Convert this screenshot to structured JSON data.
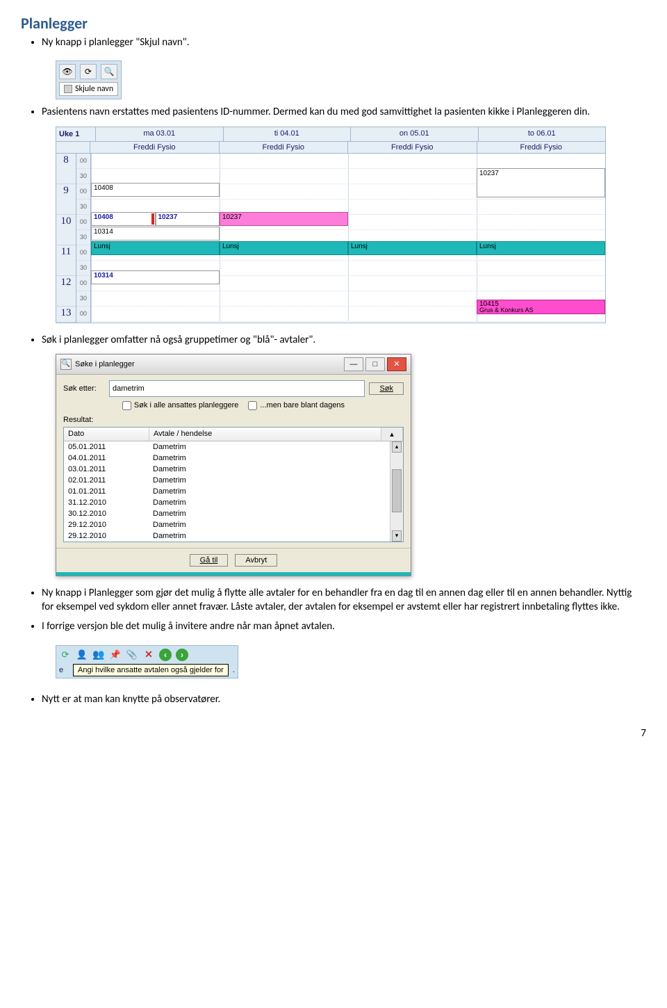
{
  "heading": "Planlegger",
  "bullets": {
    "b1": "Ny knapp i planlegger \"Skjul navn\".",
    "b2a": "Pasientens navn erstattes med pasientens ID-nummer. Dermed kan du med god samvittighet la pasienten kikke i Planleggeren din.",
    "b3": "Søk i planlegger omfatter nå også gruppetimer og \"blå\"- avtaler\".",
    "b4": "Ny knapp i Planlegger som gjør det mulig å flytte alle avtaler for en behandler fra en dag til en annen dag eller til en annen behandler. Nyttig for eksempel ved sykdom eller annet fravær. Låste avtaler, der avtalen for eksempel er avstemt eller har registrert innbetaling flyttes ikke.",
    "b5": "I forrige versjon ble det mulig å invitere andre når man åpnet avtalen.",
    "b6": "Nytt er at man kan knytte på observatører."
  },
  "mini_toolbar": {
    "skjule_label": "Skjule navn"
  },
  "calendar": {
    "week_label": "Uke 1",
    "days": [
      "ma 03.01",
      "ti 04.01",
      "on 05.01",
      "to 06.01"
    ],
    "therapist": "Freddi Fysio",
    "hours": [
      "8",
      "9",
      "10",
      "11",
      "12",
      "13"
    ],
    "mins": [
      "00",
      "30"
    ],
    "appts": {
      "a1": "10408",
      "a2": "10408",
      "a3": "10237",
      "a4": "10314",
      "a5": "10314",
      "a6": "10237",
      "a7": "10237",
      "a8": "Lunsj",
      "a9": "10415",
      "a10": "Grus & Konkurs AS"
    }
  },
  "dialog": {
    "title": "Søke i planlegger",
    "sok_etter_label": "Søk etter:",
    "sok_value": "dametrim",
    "sok_btn": "Søk",
    "chk1": "Søk i alle ansattes planleggere",
    "chk2": "...men bare blant dagens",
    "resultat_label": "Resultat:",
    "col_dato": "Dato",
    "col_avtale": "Avtale / hendelse",
    "rows": [
      {
        "dato": "05.01.2011",
        "avtale": "Dametrim"
      },
      {
        "dato": "04.01.2011",
        "avtale": "Dametrim"
      },
      {
        "dato": "03.01.2011",
        "avtale": "Dametrim"
      },
      {
        "dato": "02.01.2011",
        "avtale": "Dametrim"
      },
      {
        "dato": "01.01.2011",
        "avtale": "Dametrim"
      },
      {
        "dato": "31.12.2010",
        "avtale": "Dametrim"
      },
      {
        "dato": "30.12.2010",
        "avtale": "Dametrim"
      },
      {
        "dato": "29.12.2010",
        "avtale": "Dametrim"
      },
      {
        "dato": "29.12.2010",
        "avtale": "Dametrim"
      }
    ],
    "gaa_til": "Gå til",
    "avbryt": "Avbryt"
  },
  "appt_toolbar": {
    "tooltip": "Angi hvilke ansatte avtalen også gjelder for",
    "e": "e"
  },
  "page_number": "7"
}
